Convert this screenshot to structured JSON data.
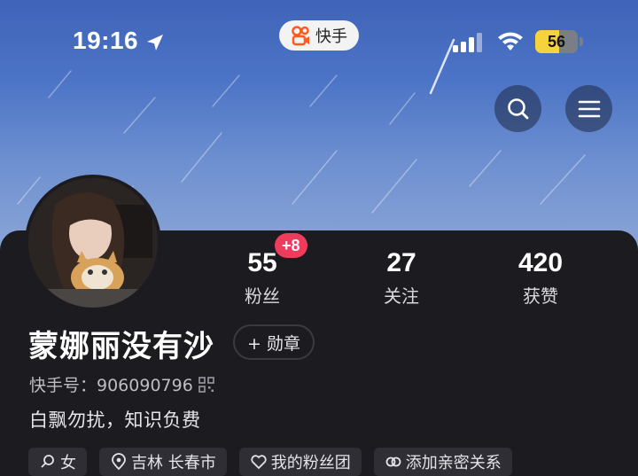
{
  "status_bar": {
    "time": "19:16",
    "app_name": "快手",
    "battery_level": 56,
    "battery_label": "56"
  },
  "profile": {
    "name": "蒙娜丽没有沙",
    "medal_label": "+ 勋章",
    "kuaishou_id": "快手号：906090796",
    "bio": "白飘勿扰，知识负费"
  },
  "stats": {
    "fans": {
      "value": "55",
      "label": "粉丝",
      "badge": "+8"
    },
    "following": {
      "value": "27",
      "label": "关注"
    },
    "likes": {
      "value": "420",
      "label": "获赞"
    }
  },
  "tags": [
    {
      "label": "女",
      "icon": "female-icon"
    },
    {
      "label": "吉林 长春市",
      "icon": "location-icon"
    },
    {
      "label": "我的粉丝团",
      "icon": "heart-icon"
    },
    {
      "label": "添加亲密关系",
      "icon": "link-icon"
    }
  ],
  "colors": {
    "background": "#1c1b20",
    "badge": "#f03c5c",
    "battery": "#f5d33d",
    "tag_bg": "#2f2e35"
  }
}
